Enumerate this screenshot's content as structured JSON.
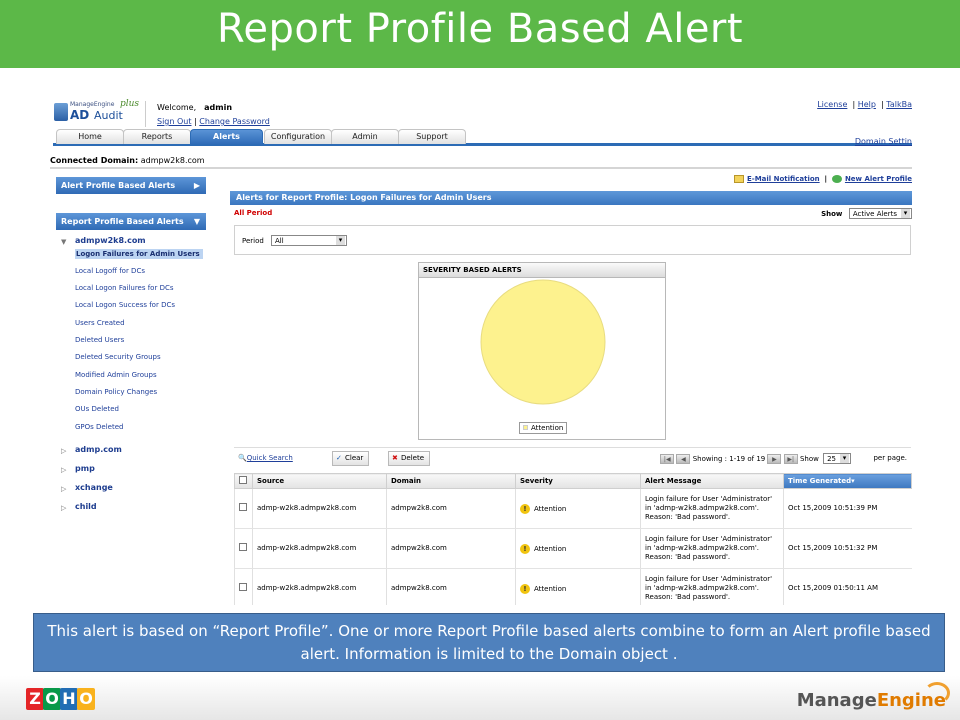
{
  "slide": {
    "title": "Report Profile Based Alert",
    "caption": "This alert is based on “Report Profile”. One or more Report Profile based alerts combine to form an Alert profile based alert. Information is limited to the Domain object ."
  },
  "header": {
    "logo_company": "ManageEngine",
    "logo_plus": "plus",
    "logo_ad": "AD",
    "logo_audit": "Audit",
    "welcome_label": "Welcome,",
    "username": "admin",
    "sign_out": "Sign Out",
    "change_password": "Change Password",
    "top_links": [
      "License",
      "Help",
      "TalkBa"
    ]
  },
  "tabs": [
    "Home",
    "Reports",
    "Alerts",
    "Configuration",
    "Admin",
    "Support"
  ],
  "active_tab": "Alerts",
  "domain_settings": "Domain Settin",
  "connected": {
    "label": "Connected Domain:",
    "value": "admpw2k8.com"
  },
  "left_panel": {
    "alert_profile_header": "Alert Profile Based Alerts",
    "report_profile_header": "Report Profile Based Alerts",
    "domains": [
      {
        "name": "admpw2k8.com",
        "expanded": true
      },
      {
        "name": "admp.com",
        "expanded": false
      },
      {
        "name": "pmp",
        "expanded": false
      },
      {
        "name": "xchange",
        "expanded": false
      },
      {
        "name": "child",
        "expanded": false
      }
    ],
    "reports": [
      "Logon Failures for Admin Users",
      "Local Logoff for DCs",
      "Local Logon Failures for DCs",
      "Local Logon Success for DCs",
      "Users Created",
      "Deleted Users",
      "Deleted Security Groups",
      "Modified Admin Groups",
      "Domain Policy Changes",
      "OUs Deleted",
      "GPOs Deleted"
    ],
    "selected_report": "Logon Failures for Admin Users"
  },
  "main": {
    "email_notification": "E-Mail Notification",
    "new_alert_profile": "New Alert Profile",
    "panel_title": "Alerts for Report Profile: Logon Failures for Admin Users",
    "all_period": "All Period",
    "show_label": "Show",
    "show_value": "Active Alerts",
    "period_label": "Period",
    "period_value": "All",
    "chart_title": "SEVERITY BASED ALERTS",
    "quick_search": "Quick Search",
    "clear_button": "Clear",
    "delete_button": "Delete",
    "showing_label": "Showing :",
    "showing_value": "1-19 of 19",
    "show_count_label": "Show",
    "per_page_value": "25",
    "per_page_label": "per page."
  },
  "chart_data": {
    "type": "pie",
    "title": "SEVERITY BASED ALERTS",
    "categories": [
      "Attention"
    ],
    "values": [
      19
    ],
    "colors": [
      "#fdf28e"
    ],
    "legend": "bottom-center"
  },
  "table": {
    "columns": [
      "Source",
      "Domain",
      "Severity",
      "Alert Message",
      "Time Generated"
    ],
    "sorted_column": "Time Generated",
    "rows": [
      {
        "source": "admp-w2k8.admpw2k8.com",
        "domain": "admpw2k8.com",
        "severity": "Attention",
        "message": "Login failure for User 'Administrator' in 'admp-w2k8.admpw2k8.com'. Reason: 'Bad password'.",
        "time": "Oct 15,2009 10:51:39 PM"
      },
      {
        "source": "admp-w2k8.admpw2k8.com",
        "domain": "admpw2k8.com",
        "severity": "Attention",
        "message": "Login failure for User 'Administrator' in 'admp-w2k8.admpw2k8.com'. Reason: 'Bad password'.",
        "time": "Oct 15,2009 10:51:32 PM"
      },
      {
        "source": "admp-w2k8.admpw2k8.com",
        "domain": "admpw2k8.com",
        "severity": "Attention",
        "message": "Login failure for User 'Administrator' in 'admp-w2k8.admpw2k8.com'. Reason: 'Bad password'.",
        "time": "Oct 15,2009 01:50:11 AM"
      }
    ]
  },
  "footer": {
    "zoho_letters": [
      "Z",
      "O",
      "H",
      "O"
    ],
    "zoho_colors": [
      "#e42527",
      "#089949",
      "#226db4",
      "#f9b21d"
    ],
    "manageengine_a": "Manage",
    "manageengine_b": "Engine"
  }
}
